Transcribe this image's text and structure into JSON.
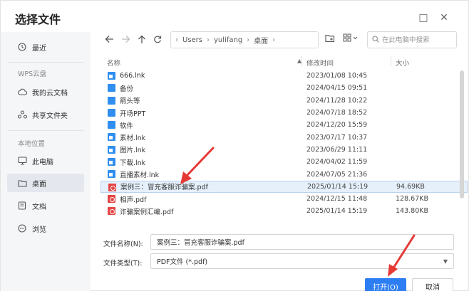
{
  "title": "选择文件",
  "window_controls": {
    "maximize": "□",
    "close": "✕"
  },
  "sidebar": {
    "items_top": [
      {
        "icon": "clock-icon",
        "label": "最近"
      }
    ],
    "wps_section": "WPS云盘",
    "wps_items": [
      {
        "icon": "cloud-icon",
        "label": "我的云文档"
      },
      {
        "icon": "share-icon",
        "label": "共享文件夹"
      }
    ],
    "local_section": "本地位置",
    "local_items": [
      {
        "icon": "monitor-icon",
        "label": "此电脑"
      },
      {
        "icon": "folder-icon",
        "label": "桌面",
        "active": true
      },
      {
        "icon": "document-icon",
        "label": "文档"
      },
      {
        "icon": "browse-icon",
        "label": "浏览"
      }
    ]
  },
  "toolbar": {
    "breadcrumb": [
      "Users",
      "yulifang",
      "桌面"
    ],
    "search_placeholder": "在此电脑中搜索"
  },
  "columns": {
    "name": "名称",
    "modified": "修改时间",
    "size": "大小"
  },
  "files": [
    {
      "type": "lnk",
      "name": "666.lnk",
      "modified": "2023/01/08 10:45",
      "size": ""
    },
    {
      "type": "folder",
      "name": "备份",
      "modified": "2024/04/15 09:51",
      "size": ""
    },
    {
      "type": "folder",
      "name": "箭头等",
      "modified": "2024/11/28 10:22",
      "size": ""
    },
    {
      "type": "folder",
      "name": "开场PPT",
      "modified": "2024/07/18 18:52",
      "size": ""
    },
    {
      "type": "folder",
      "name": "软件",
      "modified": "2024/12/20 15:59",
      "size": ""
    },
    {
      "type": "lnk",
      "name": "素材.lnk",
      "modified": "2023/07/17 10:37",
      "size": ""
    },
    {
      "type": "lnk",
      "name": "图片.lnk",
      "modified": "2023/06/29 11:11",
      "size": ""
    },
    {
      "type": "lnk",
      "name": "下载.lnk",
      "modified": "2024/04/02 11:59",
      "size": ""
    },
    {
      "type": "lnk",
      "name": "直播素材.lnk",
      "modified": "2024/07/05 21:36",
      "size": ""
    },
    {
      "type": "pdf",
      "name": "案例三：冒充客服诈骗案.pdf",
      "modified": "2025/01/14 15:19",
      "size": "94.69KB",
      "selected": true
    },
    {
      "type": "pdf",
      "name": "相声.pdf",
      "modified": "2024/12/15 11:48",
      "size": "128.67KB"
    },
    {
      "type": "pdf",
      "name": "诈骗案例汇编.pdf",
      "modified": "2025/01/14 15:19",
      "size": "143.80KB"
    }
  ],
  "bottom": {
    "filename_label": "文件名称(N):",
    "filename_value": "案例三：冒充客服诈骗案.pdf",
    "filetype_label": "文件类型(T):",
    "filetype_value": "PDF文件 (*.pdf)",
    "open_label": "打开(O)",
    "cancel_label": "取消"
  },
  "colors": {
    "accent": "#2d7ef2",
    "selected_row": "#e6f0fb",
    "annotation": "#e53935"
  }
}
